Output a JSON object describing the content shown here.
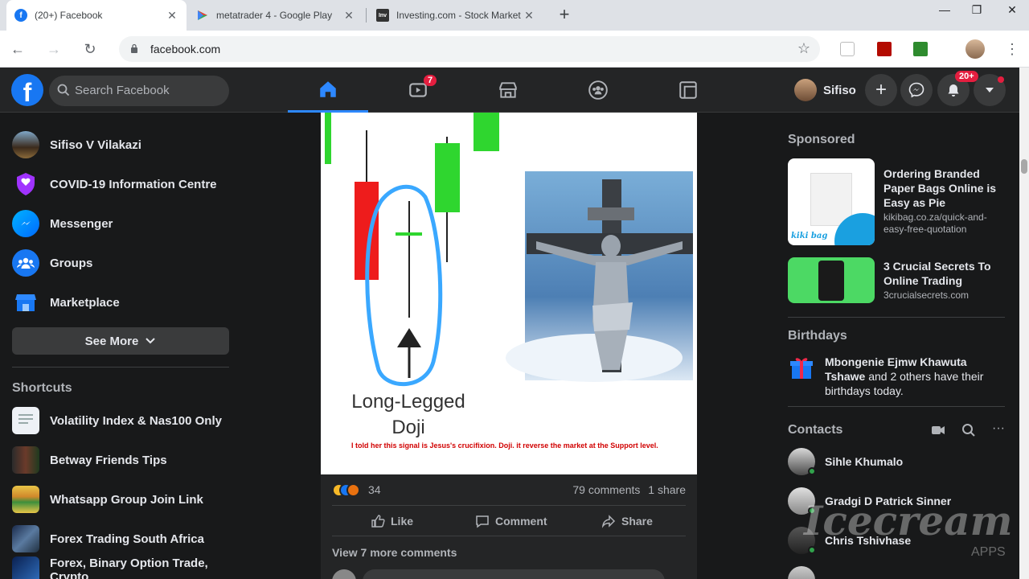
{
  "browser": {
    "tabs": [
      {
        "title": "(20+) Facebook",
        "active": true,
        "favicon": "facebook-icon"
      },
      {
        "title": "metatrader 4 - Google Play",
        "active": false,
        "favicon": "google-play-icon"
      },
      {
        "title": "Investing.com - Stock Market Q",
        "active": false,
        "favicon": "investing-icon"
      }
    ],
    "url": "facebook.com"
  },
  "header": {
    "search_placeholder": "Search Facebook",
    "watch_badge": "7",
    "profile_name": "Sifiso",
    "notifications_badge": "20+"
  },
  "sidebar": {
    "items": [
      {
        "label": "Sifiso V Vilakazi",
        "icon": "profile-avatar"
      },
      {
        "label": "COVID-19 Information Centre",
        "icon": "covid-shield-icon"
      },
      {
        "label": "Messenger",
        "icon": "messenger-icon"
      },
      {
        "label": "Groups",
        "icon": "groups-icon"
      },
      {
        "label": "Marketplace",
        "icon": "marketplace-icon"
      }
    ],
    "see_more": "See More",
    "shortcuts_heading": "Shortcuts",
    "shortcuts": [
      {
        "label": "Volatility Index & Nas100 Only"
      },
      {
        "label": "Betway Friends Tips"
      },
      {
        "label": "Whatsapp Group Join Link"
      },
      {
        "label": "Forex Trading South Africa"
      },
      {
        "label": "Forex, Binary Option Trade, Crypto"
      }
    ]
  },
  "post": {
    "image_title_line1": "Long-Legged",
    "image_title_line2": "Doji",
    "image_caption": "I told her this signal is Jesus's crucifixion. Doji. it reverse the market at the Support level.",
    "reaction_count": "34",
    "comments": "79 comments",
    "shares": "1 share",
    "like_label": "Like",
    "comment_label": "Comment",
    "share_label": "Share",
    "view_more": "View 7 more comments"
  },
  "right": {
    "sponsored_heading": "Sponsored",
    "ads": [
      {
        "title": "Ordering Branded Paper Bags Online is Easy as Pie",
        "url": "kikibag.co.za/quick-and-easy-free-quotation",
        "brand_text": "kiki bag"
      },
      {
        "title": "3 Crucial Secrets To Online Trading",
        "url": "3crucialsecrets.com"
      }
    ],
    "birthdays_heading": "Birthdays",
    "birthday_text_bold": "Mbongenie Ejmw Khawuta Tshawe",
    "birthday_text_rest": " and 2 others have their birthdays today.",
    "contacts_heading": "Contacts",
    "contacts": [
      {
        "name": "Sihle Khumalo"
      },
      {
        "name": "Gradgi D Patrick Sinner"
      },
      {
        "name": "Chris Tshivhase"
      }
    ]
  },
  "watermark": {
    "text": "Icecream",
    "sub": "APPS"
  },
  "colors": {
    "accent": "#1877f2",
    "background": "#18191a",
    "surface": "#242526",
    "badge": "#e41e3f"
  }
}
